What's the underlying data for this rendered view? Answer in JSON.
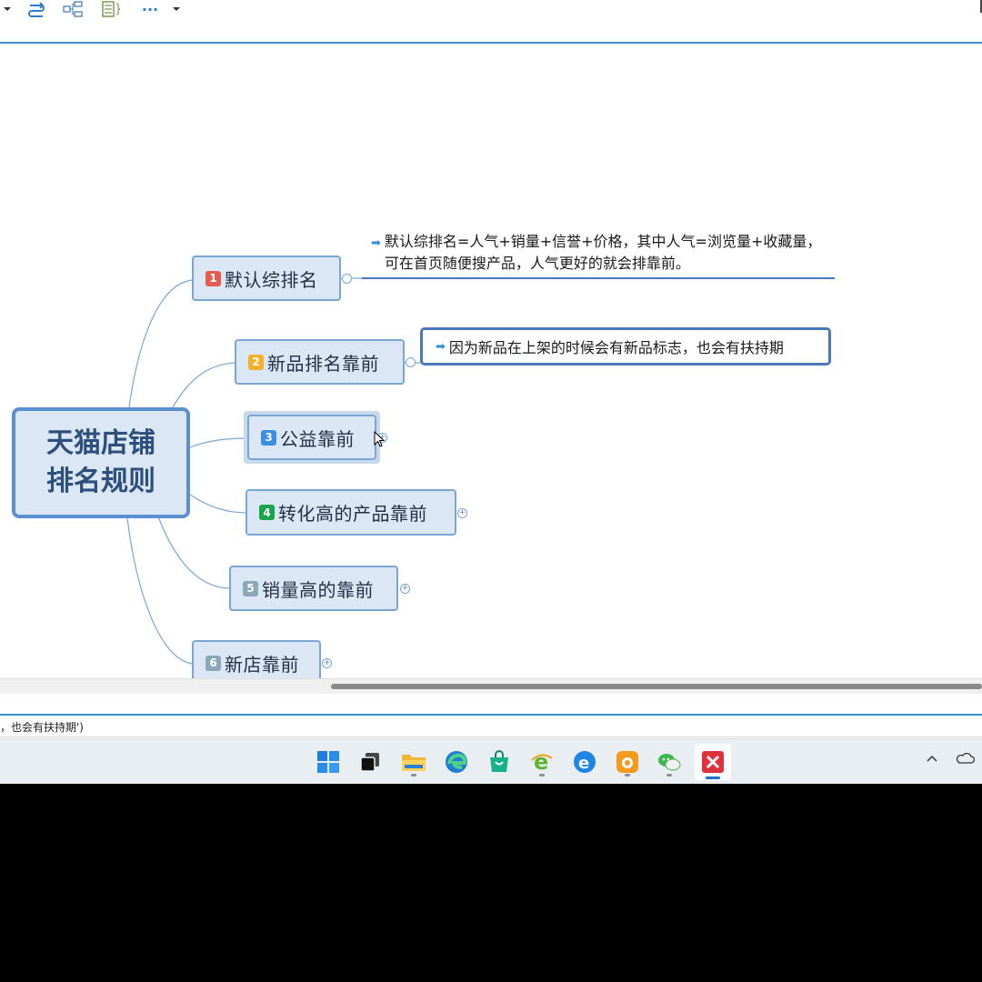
{
  "toolbar": {
    "icons": [
      "dropdown-caret-icon",
      "relationship-icon",
      "structure-icon",
      "outline-icon",
      "more-icon",
      "more-dropdown-caret-icon"
    ],
    "more_label": "···"
  },
  "mindmap": {
    "root": "天猫店铺排名规则",
    "branches": [
      {
        "marker": "1",
        "label": "默认综排名",
        "marker_color": "#e85a4f"
      },
      {
        "marker": "2",
        "label": "新品排名靠前",
        "marker_color": "#f4b02a"
      },
      {
        "marker": "3",
        "label": "公益靠前",
        "marker_color": "#3b8ee8"
      },
      {
        "marker": "4",
        "label": "转化高的产品靠前",
        "marker_color": "#19a64a"
      },
      {
        "marker": "5",
        "label": "销量高的靠前",
        "marker_color": "#8aa8b8"
      },
      {
        "marker": "6",
        "label": "新店靠前",
        "marker_color": "#8aa8b8"
      }
    ],
    "notes": {
      "branch1": "默认综排名=人气+销量+信誉+价格，其中人气=浏览量+收藏量，可在首页随便搜产品，人气更好的就会排靠前。",
      "branch2": "因为新品在上架的时候会有新品标志，也会有扶持期"
    }
  },
  "statusbar": {
    "text": "，也会有扶持期')"
  },
  "taskbar": {
    "apps": [
      "windows-start-icon",
      "task-view-icon",
      "file-explorer-icon",
      "edge-icon",
      "store-icon",
      "ie-green-icon",
      "ie-blue-icon",
      "uc-browser-icon",
      "wechat-icon",
      "xmind-icon"
    ],
    "tray": [
      "chevron-up-icon",
      "onedrive-icon"
    ]
  },
  "colors": {
    "accent": "#3a8fd6",
    "node_fill": "#dbe7f5",
    "node_border": "#7aa6d6"
  }
}
